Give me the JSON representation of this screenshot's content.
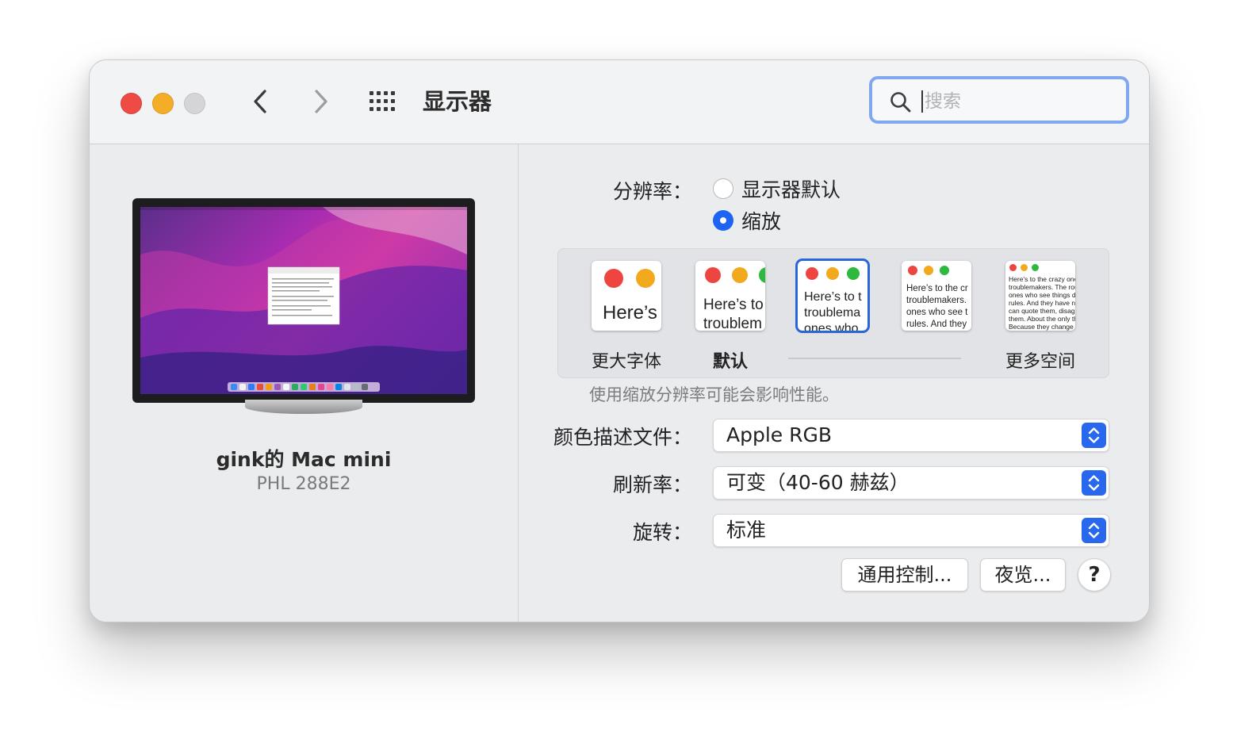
{
  "window": {
    "title": "显示器",
    "search_placeholder": "搜索"
  },
  "device": {
    "name": "gink的 Mac mini",
    "model": "PHL 288E2"
  },
  "resolution": {
    "label": "分辨率：",
    "options": [
      {
        "label": "显示器默认",
        "selected": false
      },
      {
        "label": "缩放",
        "selected": true
      }
    ]
  },
  "scaling": {
    "thumbnails": [
      {
        "text": "Here’s"
      },
      {
        "text": "Here’s to\ntroublem"
      },
      {
        "text": "Here’s to t\ntroublema\nones who"
      },
      {
        "text": "Here’s to the cr\ntroublemakers.\nones who see t\nrules. And they"
      },
      {
        "text": "Here’s to the crazy one\ntroublemakers. The rou\nones who see things dif\nrules. And they have no\ncan quote them, disagr\nthem. About the only th\nBecause they change th"
      }
    ],
    "selected_index": 2,
    "labels": {
      "larger_text": "更大字体",
      "default": "默认",
      "more_space": "更多空间"
    },
    "note": "使用缩放分辨率可能会影响性能。"
  },
  "color_profile": {
    "label": "颜色描述文件：",
    "value": "Apple RGB"
  },
  "refresh_rate": {
    "label": "刷新率：",
    "value": "可变（40-60 赫兹）"
  },
  "rotation": {
    "label": "旋转：",
    "value": "标准"
  },
  "buttons": {
    "universal_control": "通用控制...",
    "night_shift": "夜览...",
    "help": "?"
  },
  "colors": {
    "accent": "#1e63f3",
    "close": "#ed4b43",
    "minimize": "#f4ad27",
    "zoom_disabled": "#d5d5d7",
    "search_focus": "#7fa8f0"
  },
  "icons": {
    "back": "chevron-left-icon",
    "forward": "chevron-right-icon",
    "show_all": "grid-icon",
    "search": "magnifier-icon",
    "stepper": "up-down-chevron-icon"
  }
}
